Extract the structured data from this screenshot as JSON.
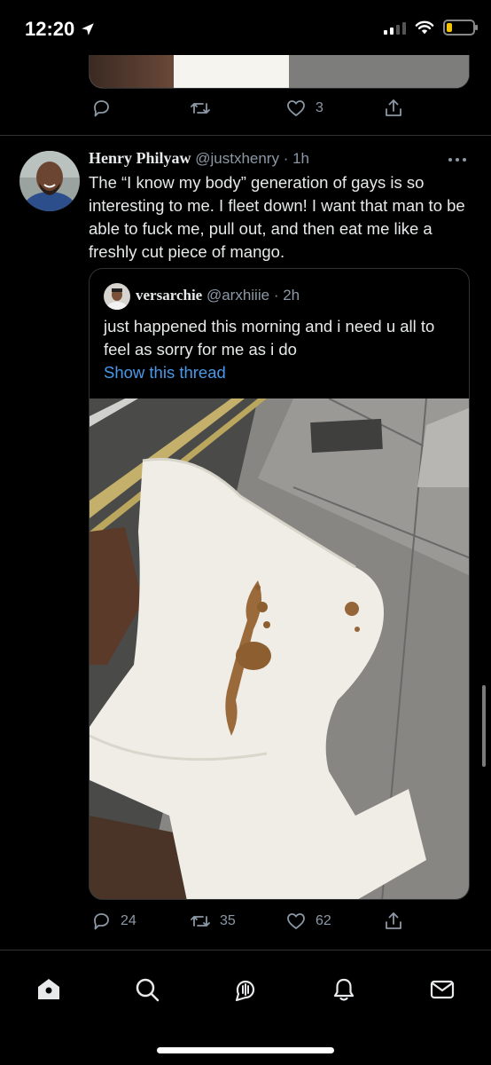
{
  "status_bar": {
    "time": "12:20",
    "battery_level": 0.2
  },
  "previous_tweet": {
    "like_count": "3"
  },
  "tweet": {
    "display_name": "Henry Philyaw",
    "handle": "@justxhenry",
    "time_ago": "· 1h",
    "text": "The “I know my body” generation of gays is so interesting to me. I fleet down! I want that man to be able to fuck me, pull out, and then eat me like a freshly cut piece of mango.",
    "reply_count": "24",
    "retweet_count": "35",
    "like_count": "62"
  },
  "quoted_tweet": {
    "display_name": "versarchie",
    "handle": "@arxhiiie",
    "time_ago": "· 2h",
    "text": "just happened this morning and i need u all to feel as sorry for me as i do",
    "show_thread": "Show this thread"
  },
  "icons": {
    "reply": "reply-icon",
    "retweet": "retweet-icon",
    "like": "like-icon",
    "share": "share-icon",
    "more": "more-icon",
    "home": "home-icon",
    "search": "search-icon",
    "spaces": "spaces-icon",
    "notifications": "notifications-icon",
    "messages": "messages-icon"
  },
  "colors": {
    "background": "#000000",
    "text": "#e7e9ea",
    "muted": "#8b98a5",
    "link": "#4a99e9",
    "border": "#2f3336"
  }
}
